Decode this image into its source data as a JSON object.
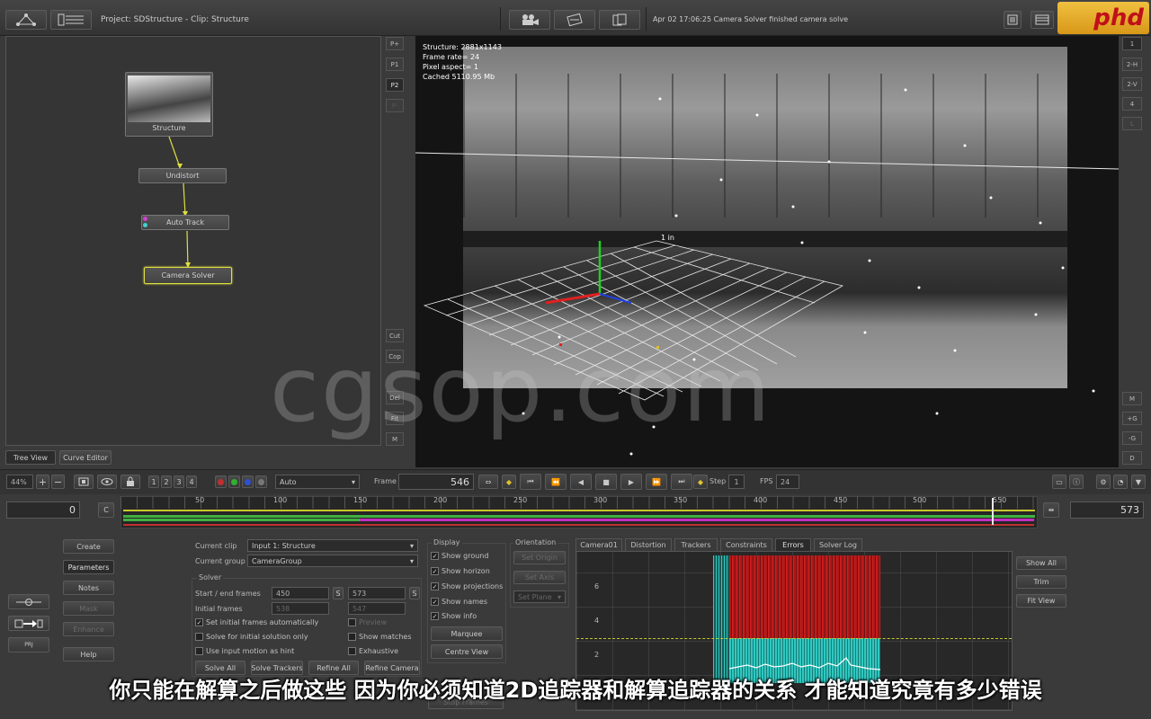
{
  "topbar": {
    "title": "Project: SDStructure - Clip: Structure",
    "status": "Apr 02 17:06:25 Camera Solver finished camera solve",
    "logo": "phd"
  },
  "left_side_buttons": [
    "P+",
    "P1",
    "P2",
    "P-",
    "Cut",
    "Cop",
    "Del",
    "Fit",
    "M"
  ],
  "right_side_buttons": [
    "1",
    "2-H",
    "2-V",
    "4",
    "L",
    "M",
    "+G",
    "-G",
    "D"
  ],
  "nodes": {
    "structure": "Structure",
    "undistort": "Undistort",
    "autotrack": "Auto Track",
    "camerasolver": "Camera Solver"
  },
  "tree_tabs": {
    "tree": "Tree View",
    "curve": "Curve Editor"
  },
  "viewer_info": {
    "structure": "Structure: 2881x1143",
    "framerate": "Frame rate= 24",
    "aspect": "Pixel aspect= 1",
    "cached": "Cached 5110.95 Mb",
    "grid_label": "1 in"
  },
  "viewer_bar": {
    "zoom": "44%",
    "views": [
      "1",
      "2",
      "3",
      "4"
    ],
    "mode": "Auto",
    "frame_label": "Frame",
    "frame_value": "546",
    "step_label": "Step",
    "step_value": "1",
    "fps_label": "FPS",
    "fps_value": "24"
  },
  "timeline": {
    "start": "0",
    "end": "573",
    "c_label": "C",
    "ticks": [
      "50",
      "100",
      "150",
      "200",
      "250",
      "300",
      "350",
      "400",
      "450",
      "500",
      "550"
    ]
  },
  "left_tools": {
    "create": "Create",
    "parameters": "Parameters",
    "notes": "Notes",
    "mask": "Mask",
    "enhance": "Enhance",
    "help": "Help"
  },
  "solver_panel": {
    "current_clip_label": "Current clip",
    "current_clip": "Input 1: Structure",
    "current_group_label": "Current group",
    "current_group": "CameraGroup",
    "solver_label": "Solver",
    "start_end_label": "Start / end frames",
    "start_frame": "450",
    "end_frame": "573",
    "s_btn": "S",
    "initial_frames_label": "Initial frames",
    "initial_start": "538",
    "initial_end": "547",
    "set_initial": "Set initial frames automatically",
    "preview": "Preview",
    "solve_initial": "Solve for initial solution only",
    "show_matches": "Show matches",
    "use_input": "Use input motion as hint",
    "exhaustive": "Exhaustive",
    "solve_all": "Solve All",
    "solve_trackers": "Solve Trackers",
    "refine_all": "Refine All",
    "refine_camera": "Refine Camera",
    "stop_frames": "Stop Frames"
  },
  "display_panel": {
    "title": "Display",
    "show_ground": "Show ground",
    "show_horizon": "Show horizon",
    "show_projections": "Show projections",
    "show_names": "Show names",
    "show_info": "Show info",
    "marquee": "Marquee",
    "centre_view": "Centre View"
  },
  "orientation_panel": {
    "title": "Orientation",
    "set_origin": "Set Origin",
    "set_axis": "Set Axis",
    "set_plane": "Set Plane"
  },
  "graph_tabs": [
    "Camera01",
    "Distortion",
    "Trackers",
    "Constraints",
    "Errors",
    "Solver Log"
  ],
  "graph": {
    "y_labels": [
      "6",
      "4",
      "2"
    ],
    "show_all": "Show All",
    "trim": "Trim",
    "fit_view": "Fit View"
  },
  "watermark": "cgsop.com",
  "subtitle": "你只能在解算之后做这些 因为你必须知道2D追踪器和解算追踪器的关系 才能知道究竟有多少错误"
}
